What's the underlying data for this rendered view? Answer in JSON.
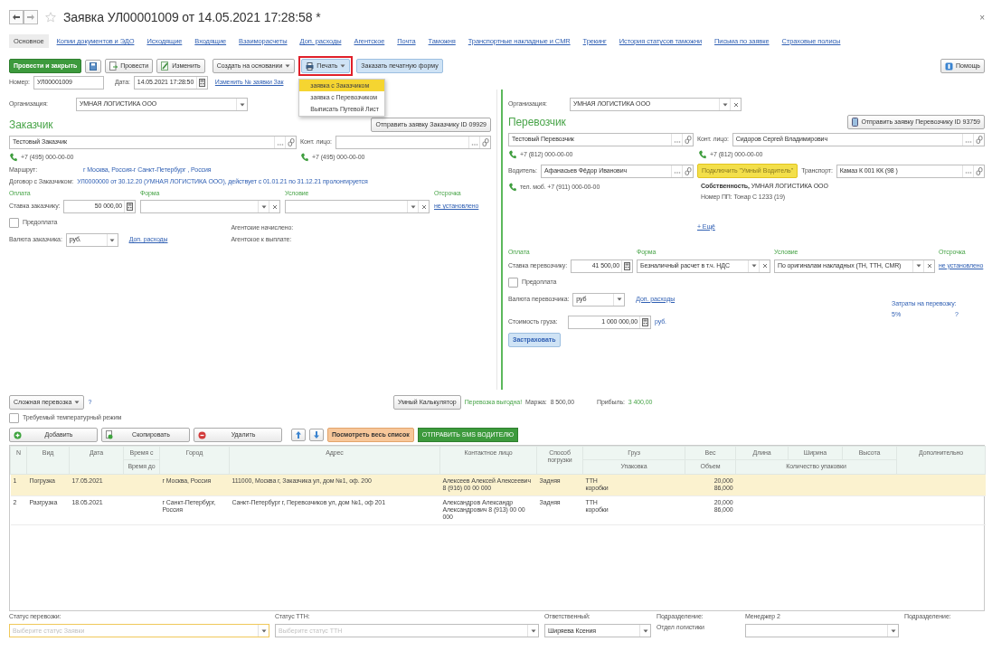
{
  "window": {
    "title": "Заявка УЛ00001009 от 14.05.2021 17:28:58 *",
    "close": "×"
  },
  "tabs": [
    {
      "label": "Основное",
      "selected": true
    },
    {
      "label": "Копии документов и ЭДО",
      "selected": false
    },
    {
      "label": "Исходящие",
      "selected": false
    },
    {
      "label": "Входящие",
      "selected": false
    },
    {
      "label": "Взаиморасчеты",
      "selected": false
    },
    {
      "label": "Доп. расходы",
      "selected": false
    },
    {
      "label": "Агентское",
      "selected": false
    },
    {
      "label": "Почта",
      "selected": false
    },
    {
      "label": "Таможня",
      "selected": false
    },
    {
      "label": "Транспортные накладные и CMR",
      "selected": false
    },
    {
      "label": "Трекинг",
      "selected": false
    },
    {
      "label": "История статусов таможни",
      "selected": false
    },
    {
      "label": "Письма по заявке",
      "selected": false
    },
    {
      "label": "Страховые полисы",
      "selected": false
    }
  ],
  "toolbar": {
    "buttons": [
      {
        "kind": "primary",
        "label": "Провести и закрыть"
      },
      {
        "kind": "save"
      },
      {
        "kind": "post",
        "label": "Провести"
      },
      {
        "kind": "edit",
        "label": "Изменить"
      },
      {
        "kind": "dropdown",
        "label": "Создать на основании"
      },
      {
        "kind": "print",
        "label": "Печать",
        "highlighted": true
      },
      {
        "kind": "accent",
        "label": "Заказать печатную форму"
      }
    ],
    "help": "Помощь"
  },
  "print_menu": [
    {
      "label": "заявка с Заказчиком",
      "selected": true
    },
    {
      "label": "заявка с Перевозчиком",
      "selected": false
    },
    {
      "label": "Выписать Путевой Лист",
      "selected": false
    }
  ],
  "header_fields": {
    "number_label": "Номер:",
    "number": "УЛ00001009",
    "date_label": "Дата:",
    "date": "14.05.2021 17:28:50",
    "rename_link": "Изменить № заявки Зак"
  },
  "customer": {
    "org_label": "Организация:",
    "org": "УМНАЯ ЛОГИСТИКА ООО",
    "heading": "Заказчик",
    "send_button": "Отправить заявку Заказчику ID 09929",
    "name": "Тестовый Заказчик",
    "contact_label": "Конт. лицо:",
    "phone": "+7 (495) 000-00-00",
    "contact_phone": "+7 (495) 000-00-00",
    "route_label": "Маршрут:",
    "route": "г Москва, Россия-г Санкт-Петербург , Россия",
    "contract_label": "Договор с Заказчиком:",
    "contract": "УЛ0000000 от 30.12.20 (УМНАЯ ЛОГИСТИКА ООО), действует с 01.01.21 по 31.12.21 пролонгируется",
    "payment": {
      "headers": [
        "Оплата",
        "Форма",
        "Условие",
        "Отсрочка"
      ],
      "rate_label": "Ставка заказчику:",
      "rate": "50 000,00",
      "deferral": "не установлено",
      "prepayment": {
        "label": "Предоплата",
        "checked": false
      },
      "currency_label": "Валюта заказчика:",
      "currency": "руб.",
      "extra_link": "Доп. расходы"
    },
    "agency_accrued": "Агентские начислено:",
    "agency_payable": "Агентское к выплате:"
  },
  "carrier": {
    "org_label": "Организация:",
    "org": "УМНАЯ ЛОГИСТИКА ООО",
    "heading": "Перевозчик",
    "send_button": "Отправить заявку Перевозчику ID 93759",
    "name": "Тестовый Перевозчик",
    "contact_label": "Конт. лицо:",
    "contact": "Сидоров Сергей Владимирович",
    "phone": "+7 (812) 000-00-00",
    "contact_phone": "+7 (812) 000-00-00",
    "driver_label": "Водитель:",
    "driver": "Афанасьев Фёдор Иванович",
    "smart_driver_button": "Подключить \"Умный Водитель\"",
    "transport_label": "Транспорт:",
    "transport": "Камаз К 001 КК (98 )",
    "driver_phone": "тел. моб. +7 (911) 000-00-00",
    "owner": "**Собственность,** УМНАЯ ЛОГИСТИКА ООО",
    "trailer": "Номер ПП: Тонар С 1233 (19)",
    "more_link": "+ Ещё",
    "payment": {
      "headers": [
        "Оплата",
        "Форма",
        "Условие",
        "Отсрочка"
      ],
      "rate_label": "Ставка перевозчику:",
      "rate": "41 500,00",
      "form": "Безналичный расчет в т.ч. НДС",
      "condition": "По оригиналам накладных (ТН, ТТН, CMR)",
      "deferral": "не установлено",
      "prepayment": {
        "label": "Предоплата",
        "checked": false
      },
      "currency_label": "Валюта перевозчика:",
      "currency": "руб",
      "extra_link": "Доп. расходы"
    },
    "costs_label": "Затраты на перевозку:",
    "costs_percent": "5%",
    "costs_value": "?",
    "cargo_value_label": "Стоимость груза:",
    "cargo_value": "1 000 000,00",
    "cargo_currency": "руб.",
    "insure_button": "Застраховать"
  },
  "summary": {
    "complex_transport": "Сложная перевозка",
    "complex_help": "?",
    "temperature": {
      "label": "Требуемый температурный режим",
      "checked": false
    },
    "calculator_button": "Умный Калькулятор",
    "verdict": "Перевозка выгодна!",
    "margin_label": "Маржа:",
    "margin": "8 500,00",
    "profit_label": "Прибыль:",
    "profit": "3 400,00"
  },
  "table_toolbar": [
    {
      "kind": "add",
      "label": "Добавить"
    },
    {
      "kind": "copy",
      "label": "Скопировать"
    },
    {
      "kind": "delete",
      "label": "Удалить"
    },
    {
      "kind": "up"
    },
    {
      "kind": "down"
    },
    {
      "kind": "show_all",
      "label": "Посмотреть весь список"
    },
    {
      "kind": "sms",
      "label": "ОТПРАВИТЬ SMS ВОДИТЕЛЮ"
    }
  ],
  "table": {
    "columns": [
      {
        "kind": "single",
        "label": "N"
      },
      {
        "kind": "single",
        "label": "Вид"
      },
      {
        "kind": "single",
        "label": "Дата"
      },
      {
        "kind": "double",
        "label": "Время с",
        "sub_label": "Время до"
      },
      {
        "kind": "single",
        "label": "Город"
      },
      {
        "kind": "single",
        "label": "Адрес"
      },
      {
        "kind": "single",
        "label": "Контактное лицо"
      },
      {
        "kind": "single",
        "label": "Способ погрузки"
      },
      {
        "kind": "double",
        "label": "Груз",
        "sub_label": "Упаковка"
      },
      {
        "kind": "double",
        "label": "Вес",
        "sub_label": "Объем"
      },
      {
        "kind": "group",
        "labels": [
          "Длина",
          "Ширина",
          "Высота"
        ],
        "sub_label": "Количество упаковки"
      },
      {
        "kind": "single",
        "label": "Дополнительно"
      }
    ],
    "rows": [
      {
        "n": "1",
        "type": "Погрузка",
        "date": "17.05.2021",
        "city": "г Москва, Россия",
        "address": "111000, Москва г, Заказчика ул, дом №1, оф. 200",
        "contact": "Алексеев Алексей Алексеевич 8 (916) 00 00 000",
        "loading": "Задняя",
        "cargo": "ТТН",
        "packaging": "коробки",
        "weight": "20,000",
        "volume": "86,000",
        "selected": true
      },
      {
        "n": "2",
        "type": "Разгрузка",
        "date": "18.05.2021",
        "city": "г Санкт-Петербург, Россия",
        "address": "Санкт-Петербург г, Перевозчиков ул, дом №1, оф 201",
        "contact": "Александров Александр Александрович 8 (913) 00 00 000",
        "loading": "Задняя",
        "cargo": "ТТН",
        "packaging": "коробки",
        "weight": "20,000",
        "volume": "86,000",
        "selected": false
      }
    ]
  },
  "footer": [
    {
      "kind": "select",
      "label": "Статус перевозки:",
      "placeholder": "Выберите статус Заявки",
      "focused": true
    },
    {
      "kind": "select",
      "label": "Статус ТТН:",
      "placeholder": "Выберите статус ТТН",
      "focused": false
    },
    {
      "kind": "select",
      "label": "Ответственный:",
      "value": "Ширяева Ксения",
      "focused": false
    },
    {
      "kind": "text",
      "label": "Подразделение:",
      "value": "Отдел логистики"
    },
    {
      "kind": "select",
      "label": "Менеджер 2",
      "focused": false
    },
    {
      "kind": "text",
      "label": "Подразделение:"
    }
  ]
}
